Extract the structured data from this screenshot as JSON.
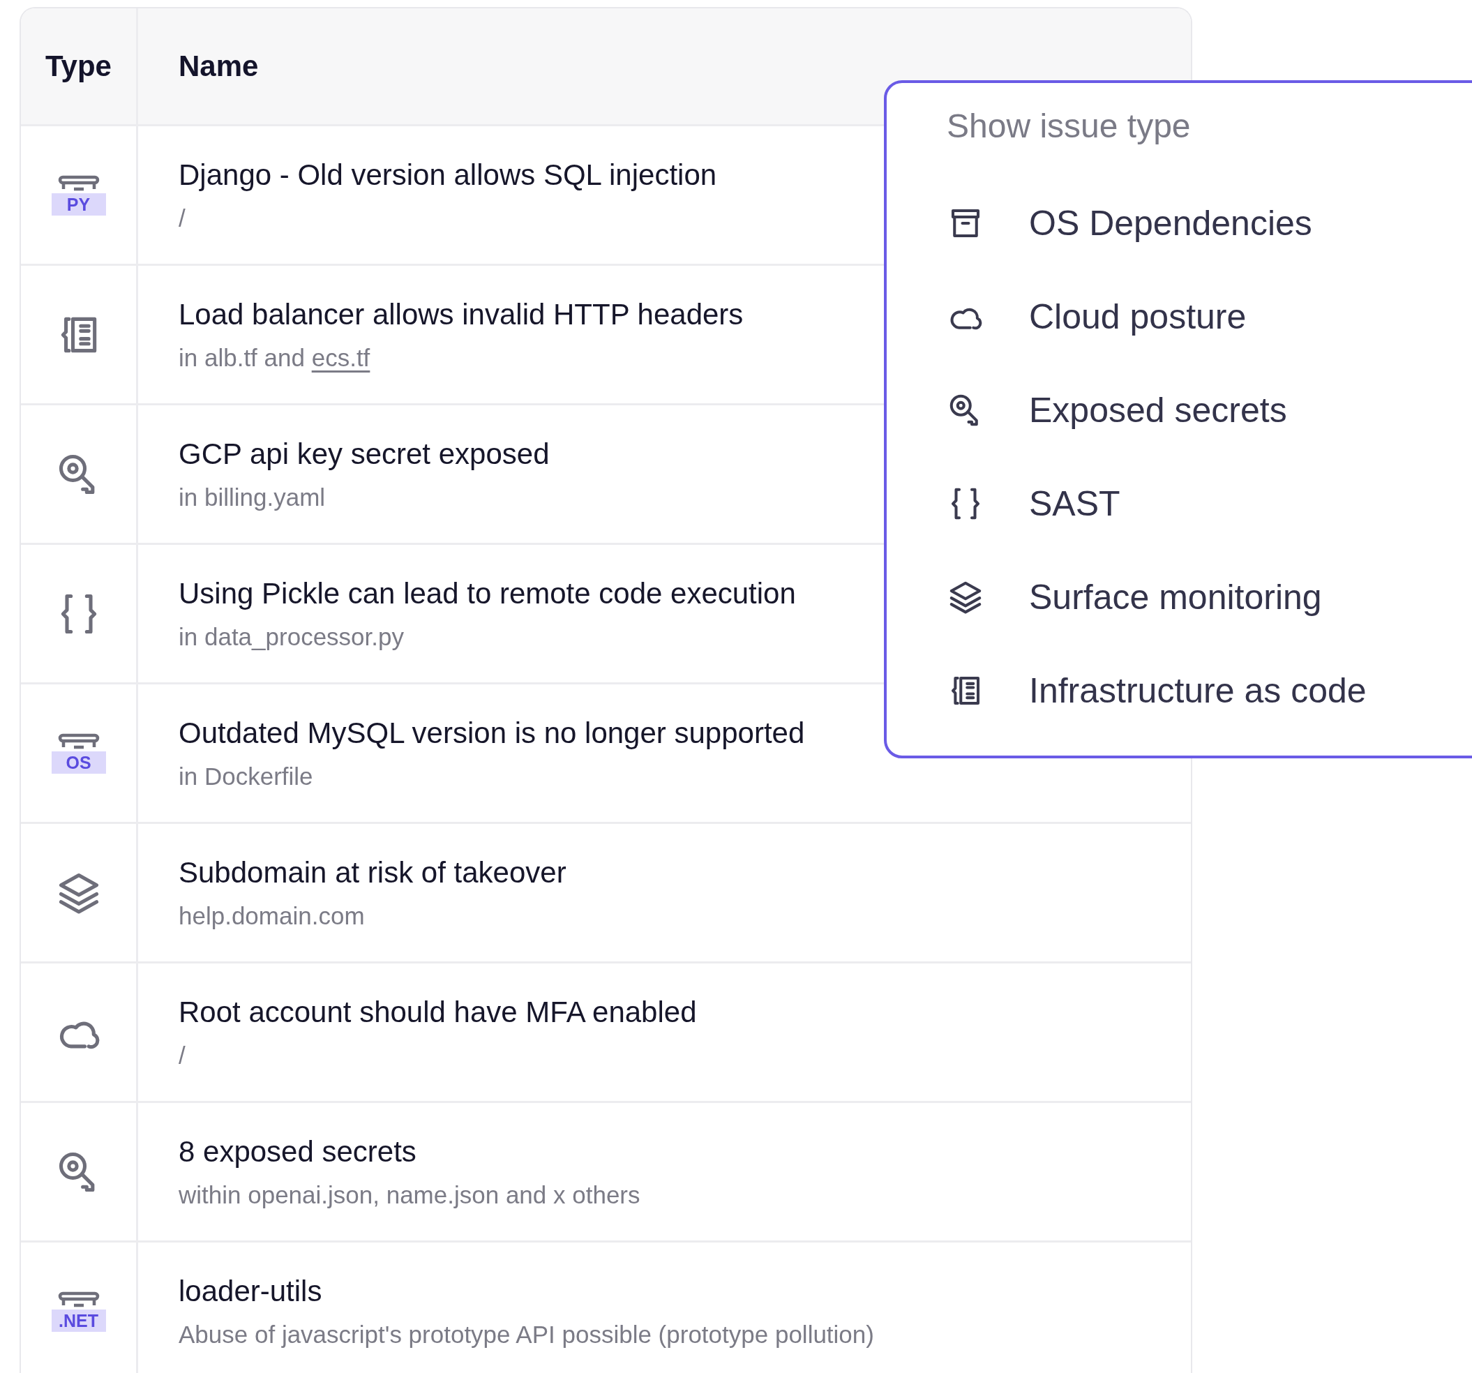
{
  "table": {
    "columns": [
      "Type",
      "Name"
    ],
    "rows": [
      {
        "kind": "package",
        "badge": "PY",
        "title": "Django - Old version allows SQL injection",
        "subtitle": "/"
      },
      {
        "kind": "iac",
        "title": "Load balancer allows invalid HTTP headers",
        "subtitle": "in alb.tf and ",
        "link": "ecs.tf"
      },
      {
        "kind": "secret",
        "title": "GCP api key secret exposed",
        "subtitle": "in billing.yaml"
      },
      {
        "kind": "sast",
        "title": "Using Pickle can lead to remote code execution",
        "subtitle": "in data_processor.py"
      },
      {
        "kind": "package",
        "badge": "OS",
        "title": "Outdated MySQL version is no longer supported",
        "subtitle": "in Dockerfile"
      },
      {
        "kind": "surface",
        "title": "Subdomain at risk of takeover",
        "subtitle": "help.domain.com"
      },
      {
        "kind": "cloud",
        "title": "Root account should have MFA enabled",
        "subtitle": "/"
      },
      {
        "kind": "secret",
        "title": "8 exposed secrets",
        "subtitle": "within openai.json, name.json and x others"
      },
      {
        "kind": "package",
        "badge": ".NET",
        "title": "loader-utils",
        "subtitle": "Abuse of javascript's prototype API possible (prototype pollution)"
      }
    ]
  },
  "dropdown": {
    "heading": "Show issue type",
    "items": [
      {
        "kind": "os",
        "label": "OS Dependencies"
      },
      {
        "kind": "cloud",
        "label": "Cloud posture"
      },
      {
        "kind": "secret",
        "label": "Exposed secrets"
      },
      {
        "kind": "sast",
        "label": "SAST"
      },
      {
        "kind": "surface",
        "label": "Surface monitoring"
      },
      {
        "kind": "iac",
        "label": "Infrastructure as code"
      }
    ]
  }
}
